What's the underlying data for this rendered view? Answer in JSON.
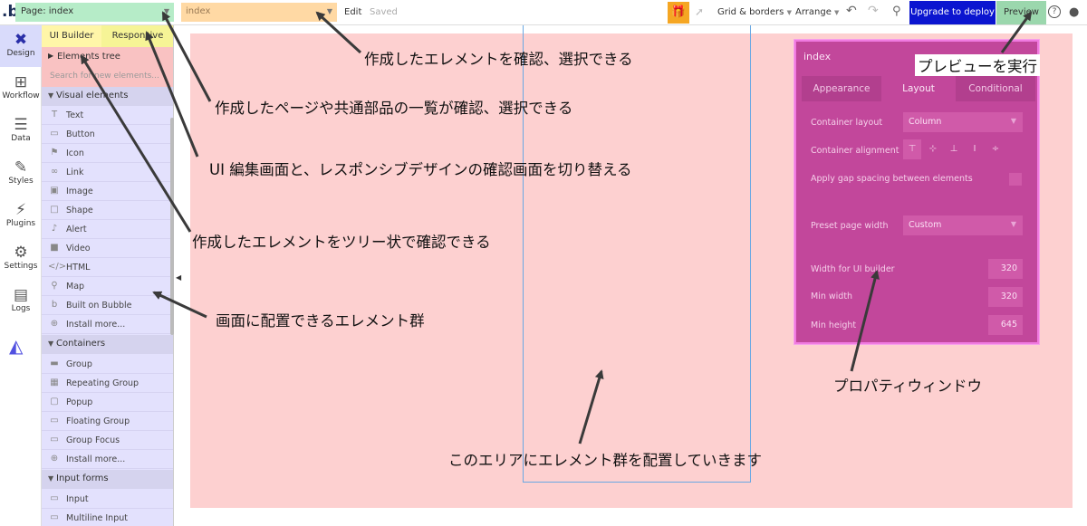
{
  "topbar": {
    "logo": ".b",
    "page_select": "Page: index",
    "element_select": "index",
    "edit": "Edit",
    "saved": "Saved",
    "grid_borders": "Grid & borders",
    "arrange": "Arrange",
    "upgrade": "Upgrade to deploy",
    "preview": "Preview",
    "help": "?"
  },
  "leftnav": [
    {
      "label": "Design",
      "icon": "design-icon"
    },
    {
      "label": "Workflow",
      "icon": "workflow-icon"
    },
    {
      "label": "Data",
      "icon": "data-icon"
    },
    {
      "label": "Styles",
      "icon": "styles-icon"
    },
    {
      "label": "Plugins",
      "icon": "plugins-icon"
    },
    {
      "label": "Settings",
      "icon": "settings-icon"
    },
    {
      "label": "Logs",
      "icon": "logs-icon"
    }
  ],
  "panel": {
    "tab_uibuilder": "UI Builder",
    "tab_responsive": "Responsive",
    "elements_tree": "Elements tree",
    "search_placeholder": "Search for new elements...",
    "visual_header": "Visual elements",
    "visual_items": [
      "Text",
      "Button",
      "Icon",
      "Link",
      "Image",
      "Shape",
      "Alert",
      "Video",
      "HTML",
      "Map",
      "Built on Bubble",
      "Install more..."
    ],
    "containers_header": "Containers",
    "container_items": [
      "Group",
      "Repeating Group",
      "Popup",
      "Floating Group",
      "Group Focus",
      "Install more..."
    ],
    "input_header": "Input forms",
    "input_items": [
      "Input",
      "Multiline Input"
    ]
  },
  "property_window": {
    "title": "index",
    "tabs": [
      "Appearance",
      "Layout",
      "Conditional"
    ],
    "container_layout_label": "Container layout",
    "container_layout_value": "Column",
    "container_alignment_label": "Container alignment",
    "gap_label": "Apply gap spacing between elements",
    "preset_width_label": "Preset page width",
    "preset_width_value": "Custom",
    "width_ui_label": "Width for UI builder",
    "width_ui_value": "320",
    "min_width_label": "Min width",
    "min_width_value": "320",
    "min_height_label": "Min height",
    "min_height_value": "645"
  },
  "annotations": {
    "element_select": "作成したエレメントを確認、選択できる",
    "preview": "プレビューを実行",
    "page_list": "作成したページや共通部品の一覧が確認、選択できる",
    "ui_responsive": "UI 編集画面と、レスポンシブデザインの確認画面を切り替える",
    "tree": "作成したエレメントをツリー状で確認できる",
    "elements": "画面に配置できるエレメント群",
    "property_window": "プロパティウィンドウ",
    "canvas": "このエリアにエレメント群を配置していきます"
  },
  "colors": {
    "page_select": "#b6ecc8",
    "element_select": "#ffd9a4",
    "upgrade": "#0b15d0",
    "preview": "#9bd7ad",
    "panel": "#e3e1fd",
    "canvas": "#fdd0d0",
    "property_window": "#c2479b"
  }
}
